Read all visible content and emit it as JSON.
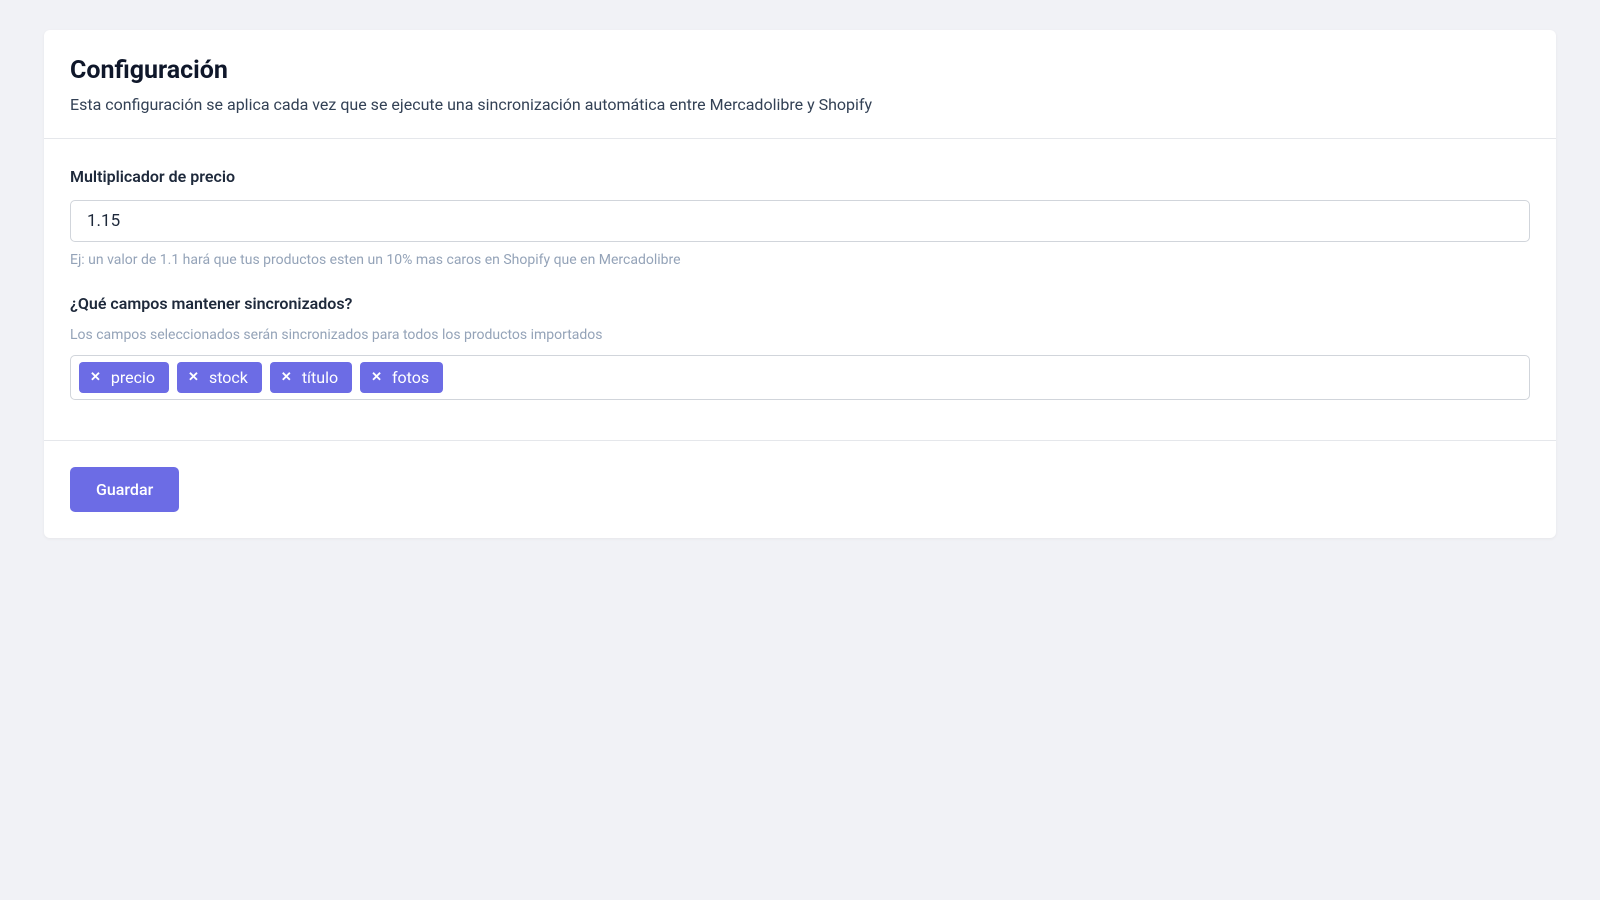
{
  "header": {
    "title": "Configuración",
    "subtitle": "Esta configuración se aplica cada vez que se ejecute una sincronización automática entre Mercadolibre y Shopify"
  },
  "form": {
    "multiplier": {
      "label": "Multiplicador de precio",
      "value": "1.15",
      "help": "Ej: un valor de 1.1 hará que tus productos esten un 10% mas caros en Shopify que en Mercadolibre"
    },
    "syncFields": {
      "label": "¿Qué campos mantener sincronizados?",
      "help": "Los campos seleccionados serán sincronizados para todos los productos importados",
      "tags": [
        "precio",
        "stock",
        "título",
        "fotos"
      ]
    }
  },
  "footer": {
    "save_label": "Guardar"
  }
}
